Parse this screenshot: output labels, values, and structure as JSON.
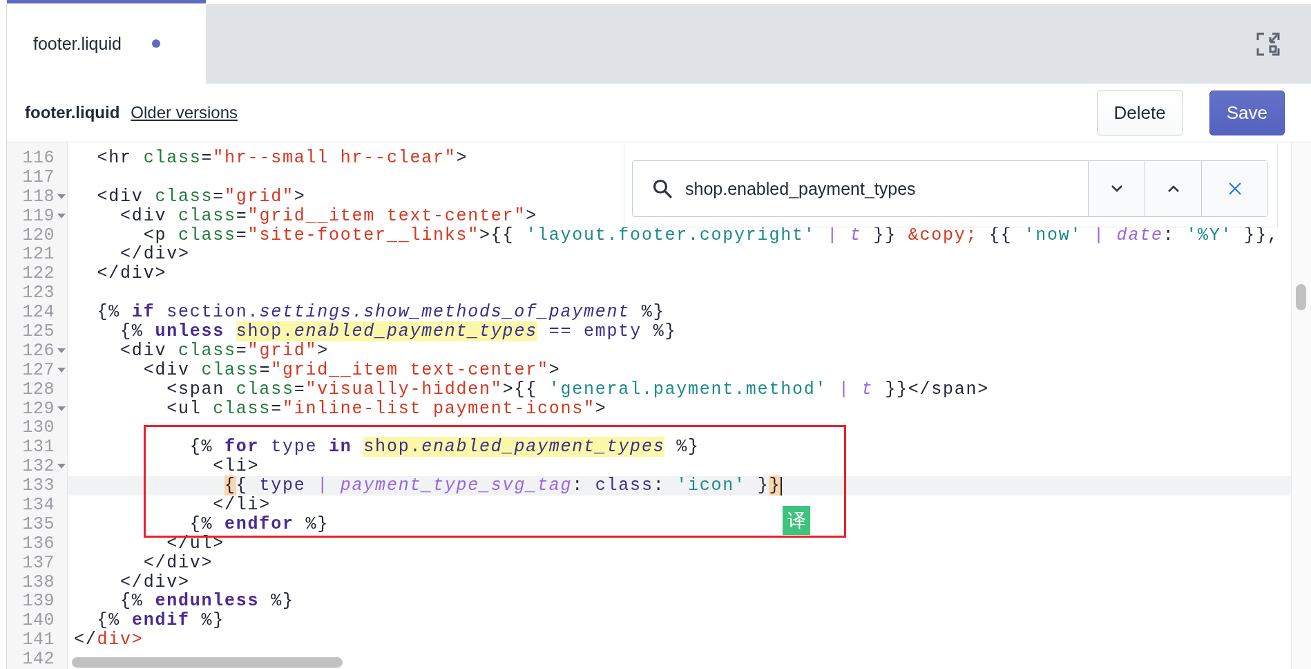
{
  "tabs": [
    {
      "label": "footer.liquid",
      "selected": true,
      "modified": true
    }
  ],
  "header": {
    "file_name": "footer.liquid",
    "older_versions_link": "Older versions"
  },
  "buttons": [
    {
      "label": "Delete",
      "kind": "secondary"
    },
    {
      "label": "Save",
      "kind": "primary"
    }
  ],
  "search": {
    "value": "shop.enabled_payment_types"
  },
  "editor": {
    "lines": [
      {
        "num": "116",
        "fold": false,
        "current": false,
        "tokens": [
          {
            "kind": "p",
            "t": "  <hr "
          },
          {
            "kind": "attr",
            "t": "class"
          },
          {
            "kind": "p",
            "t": "="
          },
          {
            "kind": "str",
            "t": "\"hr--small hr--clear\""
          },
          {
            "kind": "p",
            "t": ">"
          }
        ]
      },
      {
        "num": "117",
        "fold": false,
        "current": false
      },
      {
        "num": "118",
        "fold": true,
        "current": false,
        "tokens": [
          {
            "kind": "p",
            "t": "  <div "
          },
          {
            "kind": "attr",
            "t": "class"
          },
          {
            "kind": "p",
            "t": "="
          },
          {
            "kind": "str",
            "t": "\"grid\""
          },
          {
            "kind": "p",
            "t": ">"
          }
        ]
      },
      {
        "num": "119",
        "fold": true,
        "current": false,
        "tokens": [
          {
            "kind": "p",
            "t": "    <div "
          },
          {
            "kind": "attr",
            "t": "class"
          },
          {
            "kind": "p",
            "t": "="
          },
          {
            "kind": "str",
            "t": "\"grid__item text-center\""
          },
          {
            "kind": "p",
            "t": ">"
          }
        ]
      },
      {
        "num": "120",
        "fold": false,
        "current": false,
        "tokens": [
          {
            "kind": "p",
            "t": "      <p "
          },
          {
            "kind": "attr",
            "t": "class"
          },
          {
            "kind": "p",
            "t": "="
          },
          {
            "kind": "str",
            "t": "\"site-footer__links\""
          },
          {
            "kind": "p",
            "t": ">{{ "
          },
          {
            "kind": "lstr",
            "t": "'layout.footer.copyright'"
          },
          {
            "kind": "pipe",
            "t": " | "
          },
          {
            "kind": "lfilter",
            "t": "t"
          },
          {
            "kind": "p",
            "t": " }} "
          },
          {
            "kind": "ent",
            "t": "&copy;"
          },
          {
            "kind": "p",
            "t": " {{ "
          },
          {
            "kind": "lstr",
            "t": "'now'"
          },
          {
            "kind": "pipe",
            "t": " | "
          },
          {
            "kind": "lfilter",
            "t": "date"
          },
          {
            "kind": "p",
            "t": ": "
          },
          {
            "kind": "lstr",
            "t": "'%Y'"
          },
          {
            "kind": "p",
            "t": " }},"
          }
        ]
      },
      {
        "num": "121",
        "fold": false,
        "current": false,
        "tokens": [
          {
            "kind": "p",
            "t": "    </div>"
          }
        ]
      },
      {
        "num": "122",
        "fold": false,
        "current": false,
        "tokens": [
          {
            "kind": "p",
            "t": "  </div>"
          }
        ]
      },
      {
        "num": "123",
        "fold": false,
        "current": false
      },
      {
        "num": "124",
        "fold": false,
        "current": false,
        "tokens": [
          {
            "kind": "p",
            "t": "  {% "
          },
          {
            "kind": "lkw",
            "t": "if"
          },
          {
            "kind": "lvar",
            "t": " section."
          },
          {
            "kind": "lprop",
            "t": "settings.show_methods_of_payment"
          },
          {
            "kind": "p",
            "t": " %}"
          }
        ]
      },
      {
        "num": "125",
        "fold": false,
        "current": false,
        "tokens": [
          {
            "kind": "p",
            "t": "    {% "
          },
          {
            "kind": "lkw",
            "t": "unless "
          },
          {
            "kind": "lvar",
            "t": "shop.",
            "search_match": true
          },
          {
            "kind": "lprop",
            "t": "enabled_payment_types",
            "search_match": true
          },
          {
            "kind": "lvar",
            "t": " == empty"
          },
          {
            "kind": "p",
            "t": " %}"
          }
        ]
      },
      {
        "num": "126",
        "fold": true,
        "current": false,
        "tokens": [
          {
            "kind": "p",
            "t": "    <div "
          },
          {
            "kind": "attr",
            "t": "class"
          },
          {
            "kind": "p",
            "t": "="
          },
          {
            "kind": "str",
            "t": "\"grid\""
          },
          {
            "kind": "p",
            "t": ">"
          }
        ]
      },
      {
        "num": "127",
        "fold": true,
        "current": false,
        "tokens": [
          {
            "kind": "p",
            "t": "      <div "
          },
          {
            "kind": "attr",
            "t": "class"
          },
          {
            "kind": "p",
            "t": "="
          },
          {
            "kind": "str",
            "t": "\"grid__item text-center\""
          },
          {
            "kind": "p",
            "t": ">"
          }
        ]
      },
      {
        "num": "128",
        "fold": false,
        "current": false,
        "tokens": [
          {
            "kind": "p",
            "t": "        <span "
          },
          {
            "kind": "attr",
            "t": "class"
          },
          {
            "kind": "p",
            "t": "="
          },
          {
            "kind": "str",
            "t": "\"visually-hidden\""
          },
          {
            "kind": "p",
            "t": ">{{ "
          },
          {
            "kind": "lstr",
            "t": "'general.payment.method'"
          },
          {
            "kind": "pipe",
            "t": " | "
          },
          {
            "kind": "lfilter",
            "t": "t"
          },
          {
            "kind": "p",
            "t": " }}</span>"
          }
        ]
      },
      {
        "num": "129",
        "fold": true,
        "current": false,
        "tokens": [
          {
            "kind": "p",
            "t": "        <ul "
          },
          {
            "kind": "attr",
            "t": "class"
          },
          {
            "kind": "p",
            "t": "="
          },
          {
            "kind": "str",
            "t": "\"inline-list payment-icons\""
          },
          {
            "kind": "p",
            "t": ">"
          }
        ]
      },
      {
        "num": "130",
        "fold": false,
        "current": false
      },
      {
        "num": "131",
        "fold": false,
        "current": false,
        "tokens": [
          {
            "kind": "p",
            "t": "          {% "
          },
          {
            "kind": "lkw",
            "t": "for"
          },
          {
            "kind": "lvar",
            "t": " type "
          },
          {
            "kind": "lkw",
            "t": "in "
          },
          {
            "kind": "lvar",
            "t": "shop.",
            "search_match": true
          },
          {
            "kind": "lprop",
            "t": "enabled_payment_types",
            "search_match": true
          },
          {
            "kind": "p",
            "t": " %}"
          }
        ]
      },
      {
        "num": "132",
        "fold": true,
        "current": false,
        "tokens": [
          {
            "kind": "p",
            "t": "            <li>"
          }
        ]
      },
      {
        "num": "133",
        "fold": false,
        "current": true,
        "cursor": true,
        "tokens": [
          {
            "kind": "p",
            "t": "             {",
            "bracket_match": true
          },
          {
            "kind": "p",
            "t": "{ "
          },
          {
            "kind": "lvar",
            "t": "type"
          },
          {
            "kind": "pipe",
            "t": " | "
          },
          {
            "kind": "lfilter",
            "t": "payment_type_svg_tag"
          },
          {
            "kind": "p",
            "t": ": "
          },
          {
            "kind": "lvar",
            "t": "class"
          },
          {
            "kind": "p",
            "t": ": "
          },
          {
            "kind": "lstr",
            "t": "'icon'"
          },
          {
            "kind": "p",
            "t": " }"
          },
          {
            "kind": "p",
            "t": "}",
            "bracket_match": true
          }
        ]
      },
      {
        "num": "134",
        "fold": false,
        "current": false,
        "tokens": [
          {
            "kind": "p",
            "t": "            </li>"
          }
        ]
      },
      {
        "num": "135",
        "fold": false,
        "current": false,
        "tokens": [
          {
            "kind": "p",
            "t": "          {% "
          },
          {
            "kind": "lkw",
            "t": "endfor"
          },
          {
            "kind": "p",
            "t": " %}"
          }
        ]
      },
      {
        "num": "136",
        "fold": false,
        "current": false,
        "tokens": [
          {
            "kind": "p",
            "t": "        </ul>"
          }
        ]
      },
      {
        "num": "137",
        "fold": false,
        "current": false,
        "tokens": [
          {
            "kind": "p",
            "t": "      </div>"
          }
        ]
      },
      {
        "num": "138",
        "fold": false,
        "current": false,
        "tokens": [
          {
            "kind": "p",
            "t": "    </div>"
          }
        ]
      },
      {
        "num": "139",
        "fold": false,
        "current": false,
        "tokens": [
          {
            "kind": "p",
            "t": "    {% "
          },
          {
            "kind": "lkw",
            "t": "endunless"
          },
          {
            "kind": "p",
            "t": " %}"
          }
        ]
      },
      {
        "num": "140",
        "fold": false,
        "current": false,
        "tokens": [
          {
            "kind": "p",
            "t": "  {% "
          },
          {
            "kind": "lkw",
            "t": "endif"
          },
          {
            "kind": "p",
            "t": " %}"
          }
        ]
      },
      {
        "num": "141",
        "fold": false,
        "current": false,
        "tokens": [
          {
            "kind": "p",
            "t": "</"
          },
          {
            "kind": "str",
            "t": "div>"
          }
        ]
      },
      {
        "num": "142",
        "fold": false,
        "current": false
      }
    ]
  },
  "translate_badge": "译"
}
